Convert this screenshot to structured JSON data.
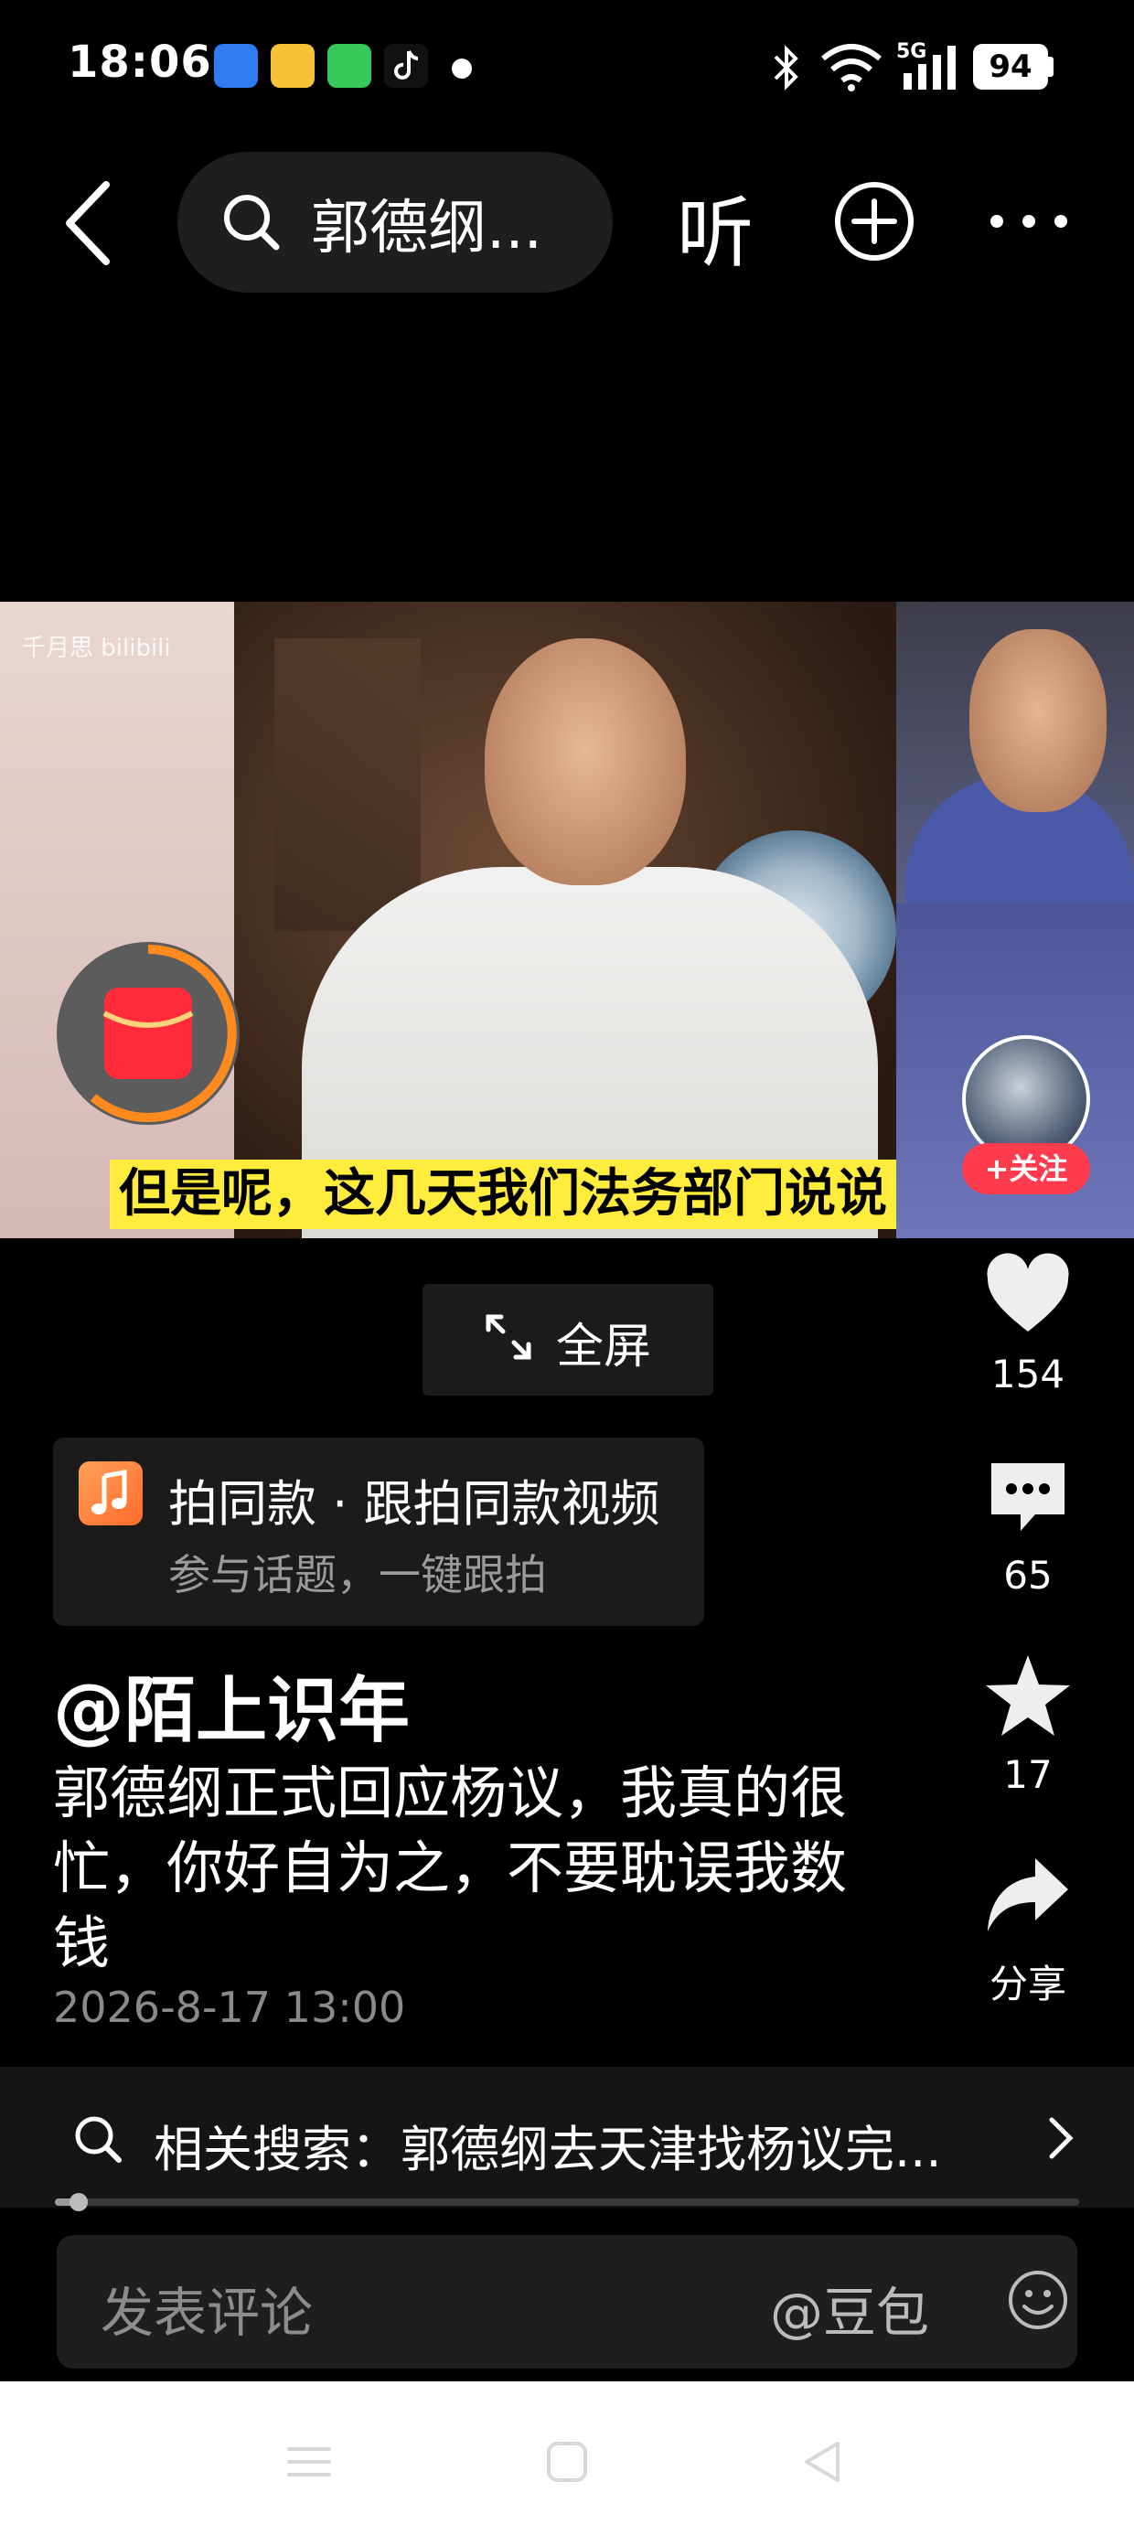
{
  "status_bar": {
    "time": "18:06",
    "network": "5G",
    "battery": "94",
    "icons": [
      "bluetooth-icon",
      "wifi-icon",
      "signal-icon"
    ]
  },
  "top_bar": {
    "search_text": "郭德纲...",
    "listen_label": "听",
    "icons": [
      "back-icon",
      "search-icon",
      "add-circle-icon",
      "more-icon"
    ]
  },
  "video": {
    "watermark": "千月思 bilibili",
    "subtitle": "但是呢，这几天我们法务部门说说",
    "follow_label": "+关注"
  },
  "fullscreen": {
    "label": "全屏"
  },
  "actions": {
    "likes": "154",
    "comments": "65",
    "favorites": "17",
    "share_label": "分享"
  },
  "music": {
    "title": "拍同款 · 跟拍同款视频",
    "subtitle": "参与话题，一键跟拍"
  },
  "post": {
    "author": "@陌上识年",
    "description": "郭德纲正式回应杨议，我真的很忙，你好自为之，不要耽误我数钱",
    "timestamp": "2026-8-17 13:00"
  },
  "related_search": {
    "label": "相关搜索：郭德纲去天津找杨议完..."
  },
  "comment_bar": {
    "placeholder": "发表评论",
    "mention": "@豆包"
  },
  "colors": {
    "background": "#000000",
    "subtitle_bg": "#ffec3d",
    "follow_red": "#ff3b4e",
    "music_orange": "#ff8a3d"
  }
}
